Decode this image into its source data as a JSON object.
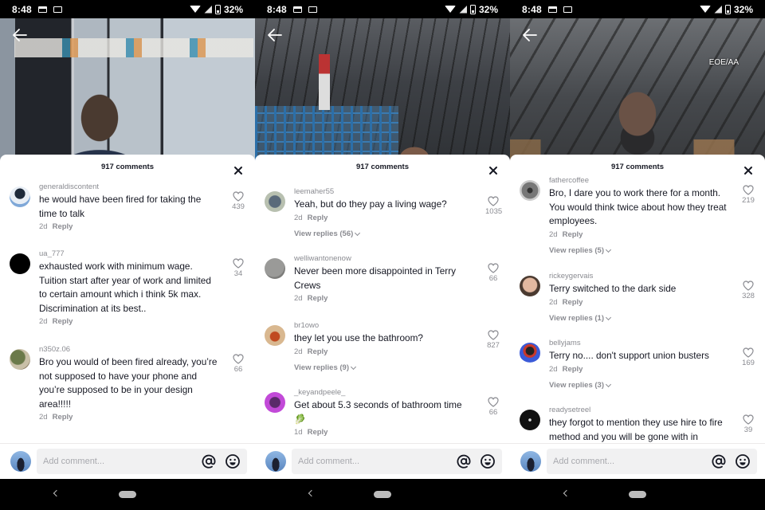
{
  "status_bar": {
    "time": "8:48",
    "battery": "32%"
  },
  "panels": [
    {
      "video_overlay_text": "",
      "sheet": {
        "title": "917 comments",
        "comments": [
          {
            "username": "generaldiscontent",
            "text": "he would have been fired for taking the time to talk",
            "age": "2d",
            "reply_label": "Reply",
            "likes": "439",
            "view_replies": ""
          },
          {
            "username": "ua_777",
            "text": "exhausted work with minimum wage. Tuition start after year of work and limited to certain amount which i think 5k max. Discrimination at its best..",
            "age": "2d",
            "reply_label": "Reply",
            "likes": "34",
            "view_replies": ""
          },
          {
            "username": "n350z.06",
            "text": "Bro you would of been fired already, you’re not supposed to have your phone and you’re supposed to be in your design area!!!!!",
            "age": "2d",
            "reply_label": "Reply",
            "likes": "66",
            "view_replies": ""
          }
        ]
      },
      "input": {
        "placeholder": "Add comment..."
      }
    },
    {
      "video_overlay_text": "",
      "sheet": {
        "title": "917 comments",
        "comments": [
          {
            "username": "leemaher55",
            "text": "Yeah, but do they pay a living wage?",
            "age": "2d",
            "reply_label": "Reply",
            "likes": "1035",
            "view_replies": "View replies (56)"
          },
          {
            "username": "welliwantonenow",
            "text": "Never been more disappointed in Terry Crews",
            "age": "2d",
            "reply_label": "Reply",
            "likes": "66",
            "view_replies": ""
          },
          {
            "username": "br1owo",
            "text": "they let you use the bathroom?",
            "age": "2d",
            "reply_label": "Reply",
            "likes": "827",
            "view_replies": "View replies (9)"
          },
          {
            "username": "_keyandpeele_",
            "text": "Get about 5.3 seconds of bathroom time 🥬",
            "age": "1d",
            "reply_label": "Reply",
            "likes": "66",
            "view_replies": ""
          }
        ]
      },
      "input": {
        "placeholder": "Add comment..."
      }
    },
    {
      "video_overlay_text": "EOE/AA",
      "sheet": {
        "title": "917 comments",
        "comments": [
          {
            "username": "fathercoffee",
            "text": "Bro, I dare you to work there for a month. You would think twice about how they treat employees.",
            "age": "2d",
            "reply_label": "Reply",
            "likes": "219",
            "view_replies": "View replies (5)"
          },
          {
            "username": "rickeygervais",
            "text": "Terry switched to the dark side",
            "age": "2d",
            "reply_label": "Reply",
            "likes": "328",
            "view_replies": "View replies (1)"
          },
          {
            "username": "bellyjams",
            "text": "Terry no.... don't support union busters",
            "age": "2d",
            "reply_label": "Reply",
            "likes": "169",
            "view_replies": "View replies (3)"
          },
          {
            "username": "readysetreel",
            "text": "they forgot to mention they use hire to fire method and you will be gone with in",
            "age": "",
            "reply_label": "",
            "likes": "39",
            "view_replies": ""
          }
        ]
      },
      "input": {
        "placeholder": "Add comment..."
      }
    }
  ],
  "icons": {
    "back": "arrow-left-icon",
    "close": "close-icon",
    "like": "heart-outline-icon",
    "mention": "at-sign-icon",
    "emoji": "smiley-icon"
  }
}
